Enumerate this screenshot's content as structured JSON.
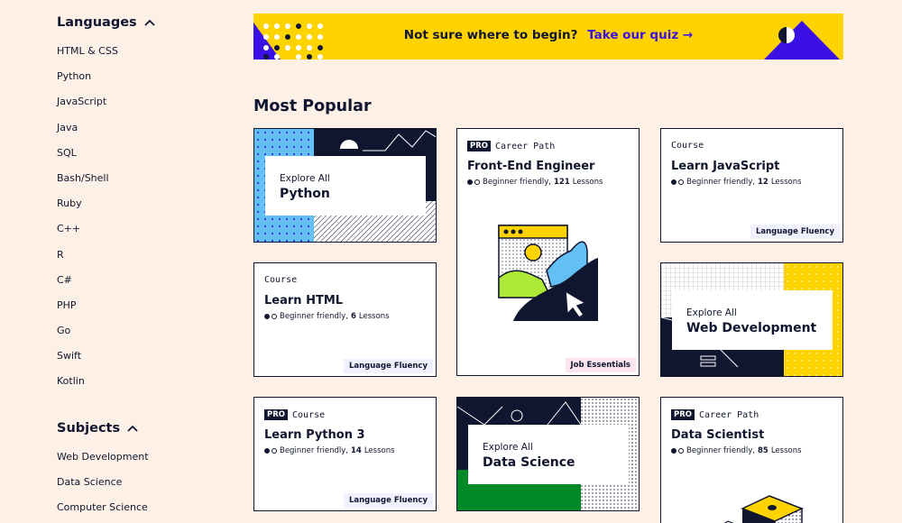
{
  "sidebar": {
    "languages": {
      "heading": "Languages",
      "items": [
        "HTML & CSS",
        "Python",
        "JavaScript",
        "Java",
        "SQL",
        "Bash/Shell",
        "Ruby",
        "C++",
        "R",
        "C#",
        "PHP",
        "Go",
        "Swift",
        "Kotlin"
      ]
    },
    "subjects": {
      "heading": "Subjects",
      "items": [
        "Web Development",
        "Data Science",
        "Computer Science"
      ]
    }
  },
  "banner": {
    "text": "Not sure where to begin?",
    "link": "Take our quiz →"
  },
  "most_popular": {
    "title": "Most Popular",
    "cards": {
      "python": {
        "small": "Explore All",
        "large": "Python"
      },
      "frontend": {
        "pro": "PRO",
        "kind": "Career Path",
        "title": "Front-End Engineer",
        "level": "Beginner friendly,",
        "count": "121",
        "unit": "Lessons",
        "tag": "Job Essentials"
      },
      "javascript": {
        "kind": "Course",
        "title": "Learn JavaScript",
        "level": "Beginner friendly,",
        "count": "12",
        "unit": "Lessons",
        "tag": "Language Fluency"
      },
      "html": {
        "kind": "Course",
        "title": "Learn HTML",
        "level": "Beginner friendly,",
        "count": "6",
        "unit": "Lessons",
        "tag": "Language Fluency"
      },
      "webdev": {
        "small": "Explore All",
        "large": "Web Development"
      },
      "python3": {
        "pro": "PRO",
        "kind": "Course",
        "title": "Learn Python 3",
        "level": "Beginner friendly,",
        "count": "14",
        "unit": "Lessons",
        "tag": "Language Fluency"
      },
      "datasci": {
        "small": "Explore All",
        "large": "Data Science"
      },
      "datascientist": {
        "pro": "PRO",
        "kind": "Career Path",
        "title": "Data Scientist",
        "level": "Beginner friendly,",
        "count": "85",
        "unit": "Lessons"
      }
    }
  },
  "colors": {
    "background": "#fdf0e6",
    "navy": "#10162f",
    "yellow": "#ffd300",
    "purple": "#3a10e5",
    "blue": "#63c0f5",
    "green": "#008a27",
    "lime": "#aee938"
  }
}
